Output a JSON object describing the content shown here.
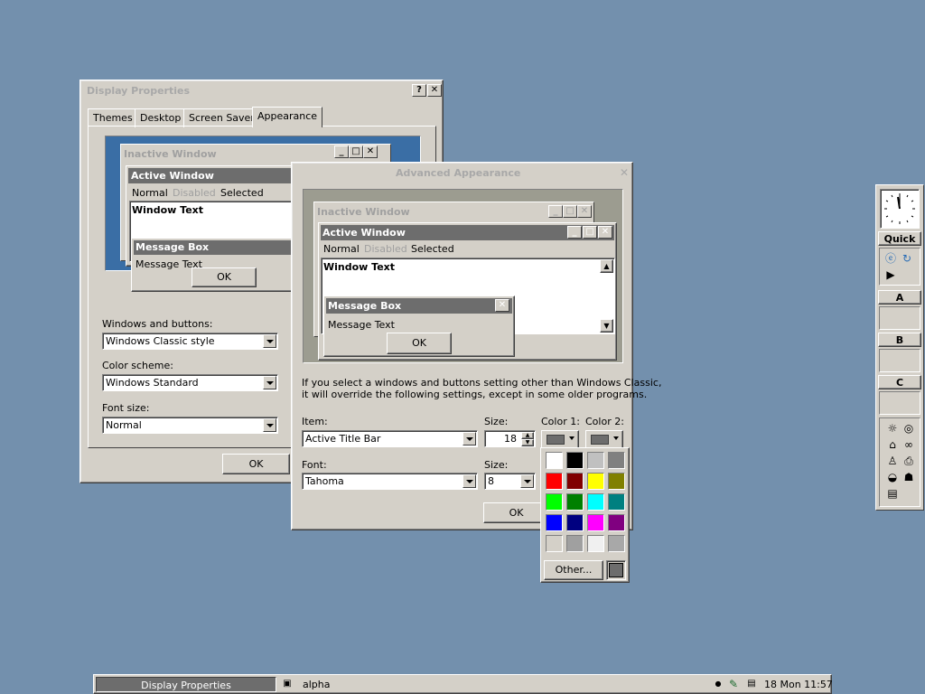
{
  "display_properties": {
    "title": "Display Properties",
    "help_btn": "?",
    "close_btn": "✕",
    "tabs": [
      "Themes",
      "Desktop",
      "Screen Saver",
      "Appearance"
    ],
    "preview": {
      "inactive_title": "Inactive Window",
      "active_title": "Active Window",
      "menu": [
        "Normal",
        "Disabled",
        "Selected"
      ],
      "window_text": "Window Text",
      "msgbox_title": "Message Box",
      "msgbox_text": "Message Text",
      "ok": "OK"
    },
    "windows_buttons_label": "Windows and buttons:",
    "windows_buttons_value": "Windows Classic style",
    "color_scheme_label": "Color scheme:",
    "color_scheme_value": "Windows Standard",
    "font_size_label": "Font size:",
    "font_size_value": "Normal",
    "ok": "OK"
  },
  "advanced": {
    "title": "Advanced Appearance",
    "close_btn": "✕",
    "preview": {
      "inactive_title": "Inactive Window",
      "active_title": "Active Window",
      "menu": [
        "Normal",
        "Disabled",
        "Selected"
      ],
      "window_text": "Window Text",
      "msgbox_title": "Message Box",
      "msgbox_text": "Message Text",
      "ok": "OK"
    },
    "info_line1": "If you select a windows and buttons setting other than Windows Classic,",
    "info_line2": "it will override the following settings, except in some older programs.",
    "item_label": "Item:",
    "item_value": "Active Title Bar",
    "size_label": "Size:",
    "size_value": "18",
    "color1_label": "Color 1:",
    "color2_label": "Color 2:",
    "font_label": "Font:",
    "font_value": "Tahoma",
    "font_size_label": "Size:",
    "font_size_value": "8",
    "ok": "OK",
    "color1": "#6d6d6d",
    "color2": "#6d6d6d"
  },
  "palette": {
    "colors": [
      "#ffffff",
      "#000000",
      "#c0c0c0",
      "#808080",
      "#ff0000",
      "#800000",
      "#ffff00",
      "#808000",
      "#00ff00",
      "#008000",
      "#00ffff",
      "#008080",
      "#0000ff",
      "#000080",
      "#ff00ff",
      "#800080",
      "#d4d0c8",
      "#a0a0a0",
      "#f0f0f0",
      "#a8a8a8"
    ],
    "other_label": "Other...",
    "current": "#6d6d6d"
  },
  "dock": {
    "quick_label": "Quick",
    "sections": [
      "A",
      "B",
      "C"
    ]
  },
  "taskbar": {
    "active_task": "Display Properties",
    "task2": "alpha",
    "clock": "18 Mon 11:57"
  }
}
